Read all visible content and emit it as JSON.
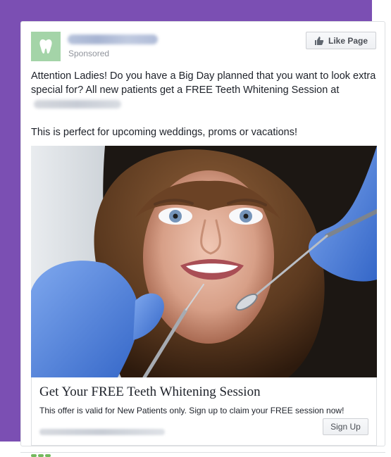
{
  "post": {
    "sponsored_label": "Sponsored",
    "like_button_label": "Like Page",
    "body_line1": "Attention Ladies! Do you have a Big Day planned that you want to look extra special for? All new patients get a FREE Teeth Whitening Session at",
    "body_line2": "This is perfect for upcoming weddings, proms or vacations!"
  },
  "ad": {
    "headline": "Get Your FREE Teeth Whitening Session",
    "description": "This offer is valid for New Patients only. Sign up to claim your FREE session now!",
    "cta_label": "Sign Up"
  },
  "colors": {
    "purple_background": "#7b4fb3",
    "avatar_background": "#a4d4a8",
    "card_border": "#dddfe2",
    "text_primary": "#1d2129",
    "text_secondary": "#90949c"
  },
  "icons": {
    "avatar": "tooth-icon",
    "like": "thumbs-up-icon"
  }
}
